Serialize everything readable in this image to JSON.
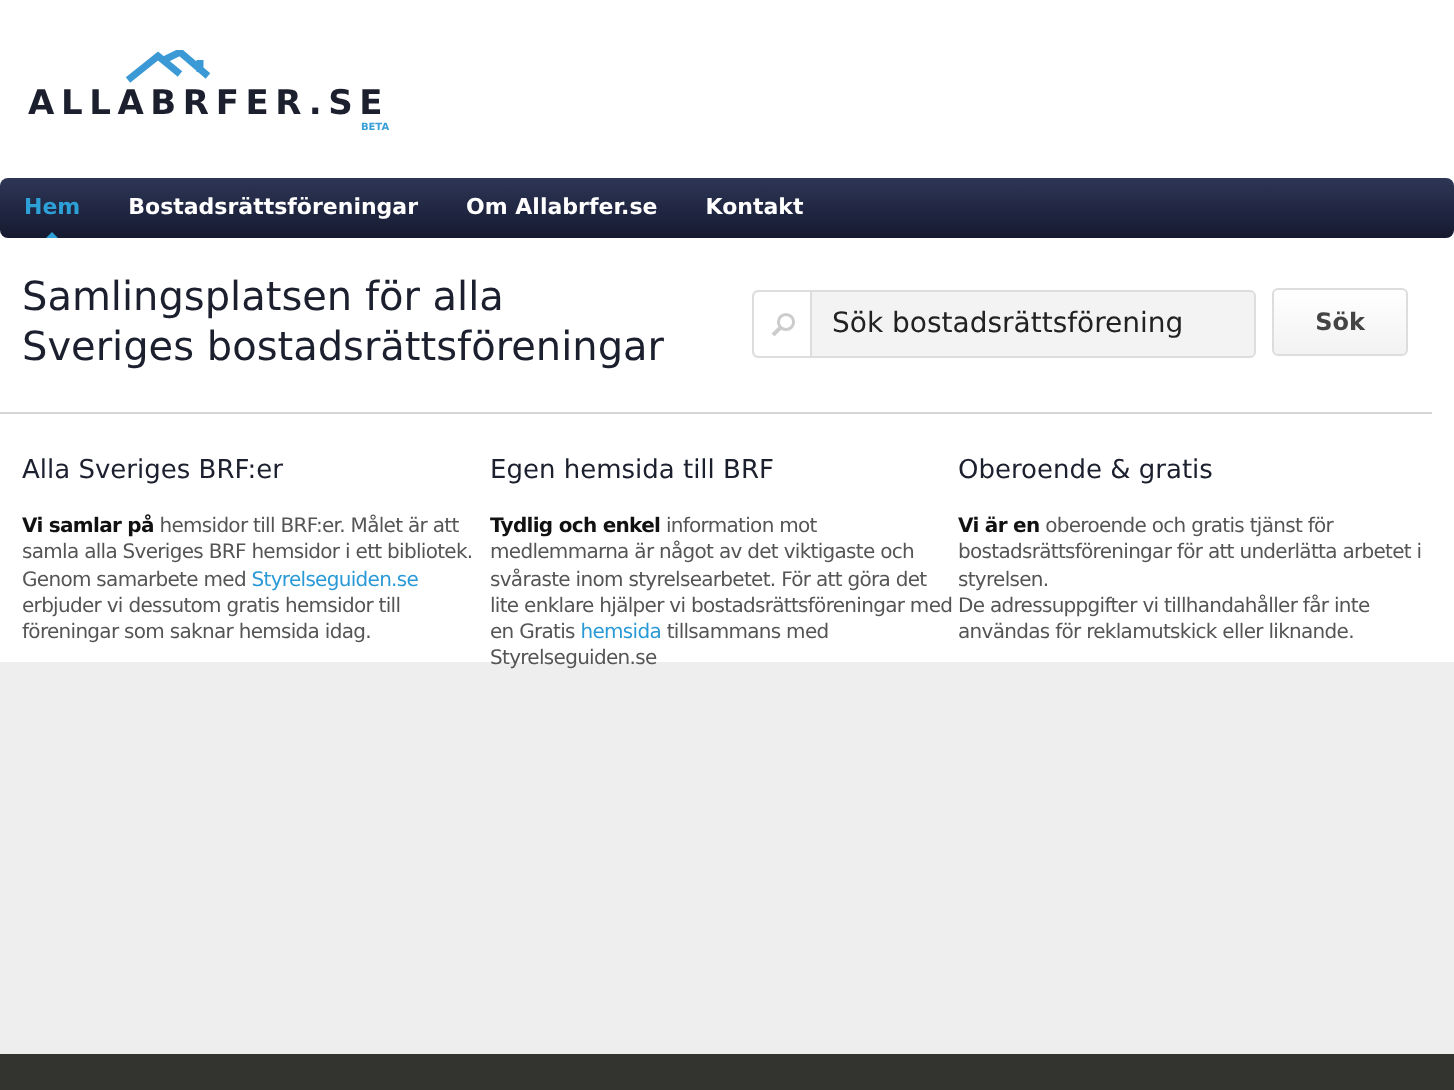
{
  "logo": {
    "name": "ALLABRFER.SE",
    "badge": "BETA"
  },
  "nav": [
    {
      "label": "Hem",
      "selected": true
    },
    {
      "label": "Bostadsrättsföreningar",
      "selected": false
    },
    {
      "label": "Om Allabrfer.se",
      "selected": false
    },
    {
      "label": "Kontakt",
      "selected": false
    }
  ],
  "headline": "Samlingsplatsen för alla Sveriges bostadsrättsföreningar",
  "search": {
    "placeholder": "Sök bostadsrättsförening",
    "button": "Sök"
  },
  "columns": [
    {
      "heading": "Alla Sveriges BRF:er",
      "paragraphs": [
        [
          {
            "kind": "text",
            "text": "**Vi samlar på** hemsidor till BRF:er. Målet är att samla alla Sveriges BRF hemsidor i ett bibliotek. Genom samarbete med "
          },
          {
            "kind": "link",
            "text": "Styrelseguiden.se"
          },
          {
            "kind": "text",
            "text": " erbjuder vi dessutom gratis hemsidor till föreningar som saknar hemsida idag."
          }
        ]
      ]
    },
    {
      "heading": "Egen hemsida till BRF",
      "paragraphs": [
        [
          {
            "kind": "text",
            "text": "**Tydlig och enkel** information mot medlemmarna är något av det viktigaste och svåraste inom styrelsearbetet. För att göra det lite enklare hjälper vi bostadsrättsföreningar med en Gratis "
          },
          {
            "kind": "link",
            "text": "hemsida"
          },
          {
            "kind": "text",
            "text": " tillsammans med Styrelseguiden.se"
          }
        ]
      ]
    },
    {
      "heading": "Oberoende & gratis",
      "paragraphs": [
        [
          {
            "kind": "text",
            "text": "**Vi är en** oberoende och gratis tjänst för bostadsrättsföreningar för att underlätta arbetet i styrelsen."
          }
        ],
        [
          {
            "kind": "text",
            "text": "De adressuppgifter vi tillhandahåller får inte användas för reklamutskick eller liknande."
          }
        ]
      ]
    }
  ]
}
